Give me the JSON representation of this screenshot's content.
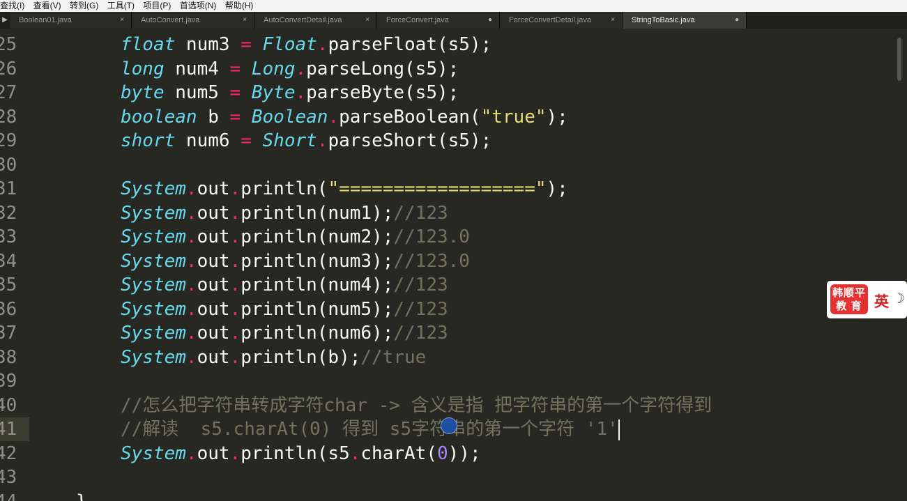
{
  "menu": [
    "查找(I)",
    "查看(V)",
    "转到(G)",
    "工具(T)",
    "项目(P)",
    "首选项(N)",
    "帮助(H)"
  ],
  "tabs": [
    {
      "label": "Boolean01.java",
      "mark": "×"
    },
    {
      "label": "AutoConvert.java",
      "mark": "×"
    },
    {
      "label": "AutoConvertDetail.java",
      "mark": "×"
    },
    {
      "label": "ForceConvert.java",
      "mark": "●"
    },
    {
      "label": "ForceConvertDetail.java",
      "mark": "×"
    },
    {
      "label": "StringToBasic.java",
      "mark": "●"
    }
  ],
  "lines": [
    {
      "n": "25",
      "tokens": [
        [
          "float",
          "type"
        ],
        [
          " num3 ",
          "var"
        ],
        [
          "=",
          "op"
        ],
        [
          " ",
          "var"
        ],
        [
          "Float",
          "type"
        ],
        [
          ".",
          "op"
        ],
        [
          "parseFloat(s5);",
          "var"
        ]
      ]
    },
    {
      "n": "26",
      "tokens": [
        [
          "long",
          "type"
        ],
        [
          " num4 ",
          "var"
        ],
        [
          "=",
          "op"
        ],
        [
          " ",
          "var"
        ],
        [
          "Long",
          "type"
        ],
        [
          ".",
          "op"
        ],
        [
          "parseLong(s5);",
          "var"
        ]
      ]
    },
    {
      "n": "27",
      "tokens": [
        [
          "byte",
          "type"
        ],
        [
          " num5 ",
          "var"
        ],
        [
          "=",
          "op"
        ],
        [
          " ",
          "var"
        ],
        [
          "Byte",
          "type"
        ],
        [
          ".",
          "op"
        ],
        [
          "parseByte(s5);",
          "var"
        ]
      ]
    },
    {
      "n": "28",
      "tokens": [
        [
          "boolean",
          "type"
        ],
        [
          " b ",
          "var"
        ],
        [
          "=",
          "op"
        ],
        [
          " ",
          "var"
        ],
        [
          "Boolean",
          "type"
        ],
        [
          ".",
          "op"
        ],
        [
          "parseBoolean(",
          "var"
        ],
        [
          "\"true\"",
          "str"
        ],
        [
          ");",
          "var"
        ]
      ]
    },
    {
      "n": "29",
      "tokens": [
        [
          "short",
          "type"
        ],
        [
          " num6 ",
          "var"
        ],
        [
          "=",
          "op"
        ],
        [
          " ",
          "var"
        ],
        [
          "Short",
          "type"
        ],
        [
          ".",
          "op"
        ],
        [
          "parseShort(s5);",
          "var"
        ]
      ]
    },
    {
      "n": "30",
      "tokens": []
    },
    {
      "n": "31",
      "tokens": [
        [
          "System",
          "type"
        ],
        [
          ".",
          "op"
        ],
        [
          "out",
          "var"
        ],
        [
          ".",
          "op"
        ],
        [
          "println(",
          "var"
        ],
        [
          "\"==================\"",
          "str"
        ],
        [
          ");",
          "var"
        ]
      ]
    },
    {
      "n": "32",
      "tokens": [
        [
          "System",
          "type"
        ],
        [
          ".",
          "op"
        ],
        [
          "out",
          "var"
        ],
        [
          ".",
          "op"
        ],
        [
          "println(num1);",
          "var"
        ],
        [
          "//123",
          "com"
        ]
      ]
    },
    {
      "n": "33",
      "tokens": [
        [
          "System",
          "type"
        ],
        [
          ".",
          "op"
        ],
        [
          "out",
          "var"
        ],
        [
          ".",
          "op"
        ],
        [
          "println(num2);",
          "var"
        ],
        [
          "//123.0",
          "com"
        ]
      ]
    },
    {
      "n": "34",
      "tokens": [
        [
          "System",
          "type"
        ],
        [
          ".",
          "op"
        ],
        [
          "out",
          "var"
        ],
        [
          ".",
          "op"
        ],
        [
          "println(num3);",
          "var"
        ],
        [
          "//123.0",
          "com"
        ]
      ]
    },
    {
      "n": "35",
      "tokens": [
        [
          "System",
          "type"
        ],
        [
          ".",
          "op"
        ],
        [
          "out",
          "var"
        ],
        [
          ".",
          "op"
        ],
        [
          "println(num4);",
          "var"
        ],
        [
          "//123",
          "com"
        ]
      ]
    },
    {
      "n": "36",
      "tokens": [
        [
          "System",
          "type"
        ],
        [
          ".",
          "op"
        ],
        [
          "out",
          "var"
        ],
        [
          ".",
          "op"
        ],
        [
          "println(num5);",
          "var"
        ],
        [
          "//123",
          "com"
        ]
      ]
    },
    {
      "n": "37",
      "tokens": [
        [
          "System",
          "type"
        ],
        [
          ".",
          "op"
        ],
        [
          "out",
          "var"
        ],
        [
          ".",
          "op"
        ],
        [
          "println(num6);",
          "var"
        ],
        [
          "//123",
          "com"
        ]
      ]
    },
    {
      "n": "38",
      "tokens": [
        [
          "System",
          "type"
        ],
        [
          ".",
          "op"
        ],
        [
          "out",
          "var"
        ],
        [
          ".",
          "op"
        ],
        [
          "println(b);",
          "var"
        ],
        [
          "//true",
          "com"
        ]
      ]
    },
    {
      "n": "39",
      "tokens": []
    },
    {
      "n": "40",
      "tokens": [
        [
          "//怎么把字符串转成字符char -> 含义是指 把字符串的第一个字符得到",
          "com"
        ]
      ]
    },
    {
      "n": "41",
      "current": true,
      "tokens": [
        [
          "//解读  s5.charAt(0) 得到 s5字符串的第一个字符 '1'",
          "com"
        ]
      ]
    },
    {
      "n": "42",
      "tokens": [
        [
          "System",
          "type"
        ],
        [
          ".",
          "op"
        ],
        [
          "out",
          "var"
        ],
        [
          ".",
          "op"
        ],
        [
          "println(s5",
          "var"
        ],
        [
          ".",
          "op"
        ],
        [
          "charAt(",
          "var"
        ],
        [
          "0",
          "num"
        ],
        [
          "));",
          "var"
        ]
      ]
    },
    {
      "n": "43",
      "tokens": []
    },
    {
      "n": "44",
      "brace": true,
      "tokens": [
        [
          "}",
          "var"
        ]
      ]
    }
  ],
  "ime": {
    "logo_line1": "韩顺平",
    "logo_line2": "教 育",
    "lang": "英",
    "moon": "☽"
  }
}
